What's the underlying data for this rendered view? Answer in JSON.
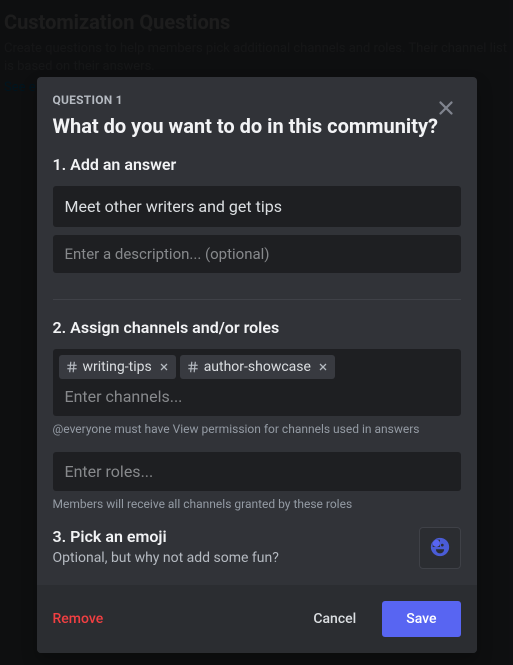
{
  "background": {
    "title": "Customization Questions",
    "subtitle": "Create questions to help members pick additional channels and roles. Their channel list is based on their answers.",
    "link": "See e"
  },
  "modal": {
    "label": "QUESTION 1",
    "title": "What do you want to do in this community?",
    "section1": {
      "title": "1. Add an answer",
      "answer_value": "Meet other writers and get tips",
      "description_placeholder": "Enter a description... (optional)"
    },
    "section2": {
      "title": "2. Assign channels and/or roles",
      "channels": [
        {
          "name": "writing-tips"
        },
        {
          "name": "author-showcase"
        }
      ],
      "channels_placeholder": "Enter channels...",
      "channels_helper": "@everyone must have View permission for channels used in answers",
      "roles_placeholder": "Enter roles...",
      "roles_helper": "Members will receive all channels granted by these roles"
    },
    "section3": {
      "title": "3. Pick an emoji",
      "subtitle": "Optional, but why not add some fun?"
    },
    "footer": {
      "remove": "Remove",
      "cancel": "Cancel",
      "save": "Save"
    }
  }
}
